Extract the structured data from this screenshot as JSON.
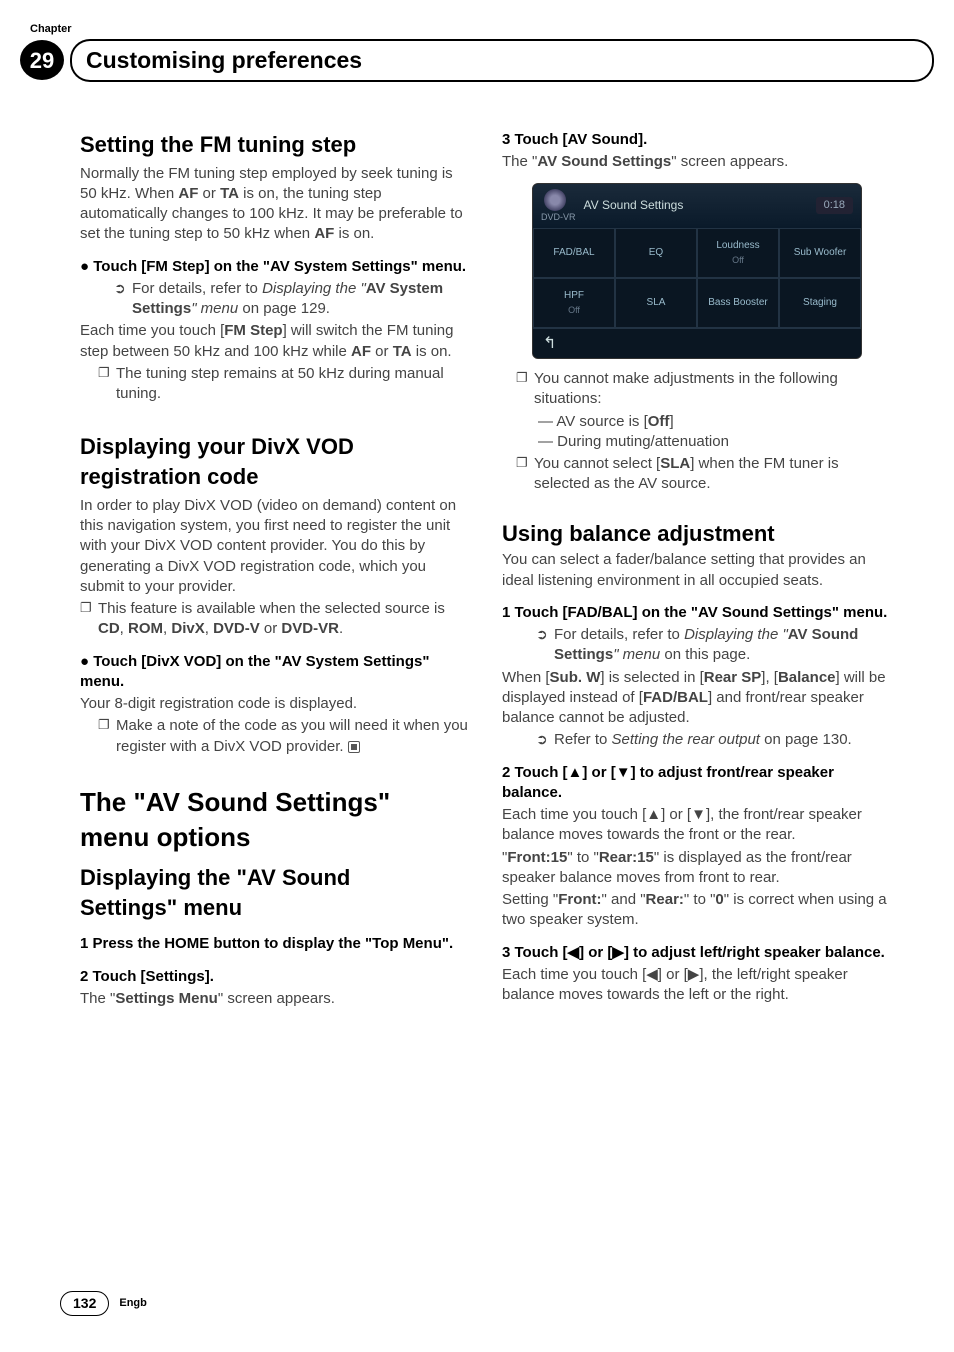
{
  "header": {
    "chapter_label": "Chapter",
    "chapter_num": "29",
    "title": "Customising preferences"
  },
  "left": {
    "fm": {
      "title": "Setting the FM tuning step",
      "body1": "Normally the FM tuning step employed by seek tuning is 50 kHz. When ",
      "af": "AF",
      "or": " or ",
      "ta": "TA",
      "body2": " is on, the tuning step automatically changes to 100 kHz. It may be preferable to set the tuning step to 50 kHz when ",
      "af2": "AF",
      "body3": " is on.",
      "step_bullet": "●   Touch [FM Step] on the \"AV System Settings\" menu.",
      "ref_pre": "For details, refer to ",
      "ref_it": "Displaying the \"",
      "ref_bold": "AV System Settings",
      "ref_it2": "\" menu",
      "ref_post": " on page 129.",
      "each_pre": "Each time you touch [",
      "fmstep": "FM Step",
      "each_mid": "] will switch the FM tuning step between 50 kHz and 100 kHz while ",
      "af3": "AF",
      "or2": " or ",
      "ta2": "TA",
      "each_post": " is on.",
      "note1": "The tuning step remains at 50 kHz during manual tuning."
    },
    "divx": {
      "title1": "Displaying your DivX VOD",
      "title2": "registration code",
      "body": "In order to play DivX VOD (video on demand) content on this navigation system, you first need to register the unit with your DivX VOD content provider. You do this by generating a DivX VOD registration code, which you submit to your provider.",
      "note_pre": "This feature is available when the selected source is ",
      "cd": "CD",
      "c1": ", ",
      "rom": "ROM",
      "c2": ", ",
      "dx": "DivX",
      "c3": ", ",
      "dvdv": "DVD-V",
      "or": " or ",
      "dvdvr": "DVD-VR",
      "dot": ".",
      "step": "●   Touch [DivX VOD] on the \"AV System Settings\" menu.",
      "y8": "Your 8-digit registration code is displayed.",
      "note2": "Make a note of the code as you will need it when you register with a DivX VOD provider."
    },
    "avsound": {
      "big1": "The \"AV Sound Settings\"",
      "big2": "menu options",
      "sub1": "Displaying the \"AV Sound",
      "sub2": "Settings\" menu",
      "s1": "1    Press the HOME button to display the \"Top Menu\".",
      "s2": "2    Touch [Settings].",
      "s2b_pre": "The \"",
      "s2b_bold": "Settings Menu",
      "s2b_post": "\" screen appears."
    }
  },
  "right": {
    "s3": "3    Touch [AV Sound].",
    "s3b_pre": "The \"",
    "s3b_bold": "AV Sound Settings",
    "s3b_post": "\" screen appears.",
    "ss": {
      "src": "DVD-VR",
      "title": "AV Sound Settings",
      "time": "0:18",
      "cells": [
        {
          "l": "FAD/BAL",
          "s": ""
        },
        {
          "l": "EQ",
          "s": ""
        },
        {
          "l": "Loudness",
          "s": "Off"
        },
        {
          "l": "Sub Woofer",
          "s": ""
        },
        {
          "l": "HPF",
          "s": "Off"
        },
        {
          "l": "SLA",
          "s": ""
        },
        {
          "l": "Bass Booster",
          "s": ""
        },
        {
          "l": "Staging",
          "s": ""
        }
      ],
      "back": "↰"
    },
    "n1": "You cannot make adjustments in the following situations:",
    "d1_pre": "AV source is [",
    "d1_b": "Off",
    "d1_post": "]",
    "d2": "During muting/attenuation",
    "n2_pre": "You cannot select [",
    "n2_b": "SLA",
    "n2_post": "] when the FM tuner is selected as the AV source.",
    "bal": {
      "title": "Using balance adjustment",
      "body": "You can select a fader/balance setting that provides an ideal listening environment in all occupied seats.",
      "s1": "1    Touch [FAD/BAL] on the \"AV Sound Settings\" menu.",
      "ref_pre": "For details, refer to ",
      "ref_it": "Displaying the \"",
      "ref_b": "AV Sound Settings",
      "ref_it2": "\" menu",
      "ref_post": " on this page.",
      "when_pre": "When [",
      "subw": "Sub. W",
      "when_mid": "] is selected in [",
      "rearsp": "Rear SP",
      "when_mid2": "], [",
      "balance": "Balance",
      "when_mid3": "] will be displayed instead of [",
      "fadbal": "FAD/BAL",
      "when_post": "] and front/rear speaker balance cannot be adjusted.",
      "ref2_pre": "Refer to ",
      "ref2_it": "Setting the rear output",
      "ref2_post": " on page 130.",
      "s2": "2    Touch [▲] or [▼] to adjust front/rear speaker balance.",
      "s2b": "Each time you touch [▲] or [▼], the front/rear speaker balance moves towards the front or the rear.",
      "s2c_q1": "\"",
      "front15": "Front:15",
      "s2c_mid": "\" to \"",
      "rear15": "Rear:15",
      "s2c_post": "\" is displayed as the front/rear speaker balance moves from front to rear.",
      "s2d_pre": "Setting \"",
      "frontc": "Front:",
      "s2d_mid": "\" and \"",
      "rearc": "Rear:",
      "s2d_mid2": "\" to \"",
      "zero": "0",
      "s2d_post": "\" is correct when using a two speaker system.",
      "s3": "3    Touch [◀] or [▶] to adjust left/right speaker balance.",
      "s3b": "Each time you touch [◀] or [▶], the left/right speaker balance moves towards the left or the right."
    }
  },
  "footer": {
    "page": "132",
    "lang": "Engb"
  }
}
